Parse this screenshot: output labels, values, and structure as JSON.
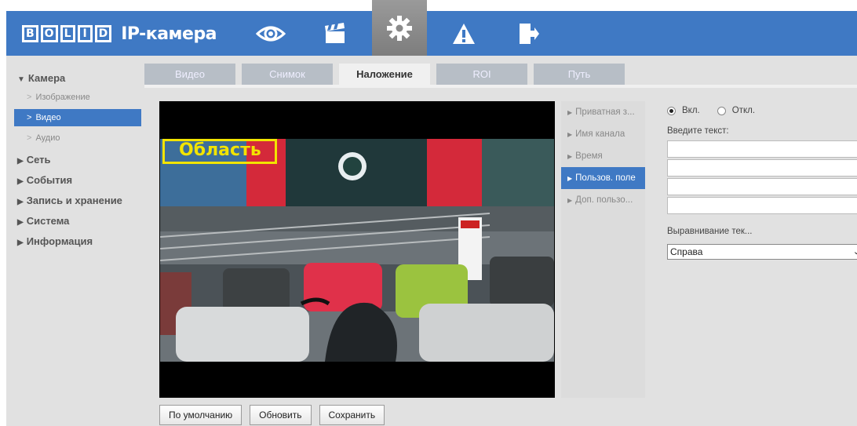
{
  "header": {
    "logo_letters": [
      "B",
      "O",
      "L",
      "I",
      "D"
    ],
    "app_title": "IP-камера",
    "nav_icons": [
      {
        "name": "live-view-eye-icon",
        "active": false
      },
      {
        "name": "playback-clapper-icon",
        "active": false
      },
      {
        "name": "settings-gear-icon",
        "active": true
      },
      {
        "name": "alarm-warning-icon",
        "active": false
      },
      {
        "name": "logout-door-icon",
        "active": false
      }
    ],
    "brand_color": "#3f79c4"
  },
  "sidebar": {
    "groups": [
      {
        "label": "Камера",
        "expanded": true
      },
      {
        "label": "Сеть"
      },
      {
        "label": "События"
      },
      {
        "label": "Запись и хранение"
      },
      {
        "label": "Система"
      },
      {
        "label": "Информация"
      }
    ],
    "camera_items": [
      {
        "label": "Изображение"
      },
      {
        "label": "Видео",
        "selected": true
      },
      {
        "label": "Аудио"
      }
    ]
  },
  "tabs": [
    {
      "label": "Видео"
    },
    {
      "label": "Снимок"
    },
    {
      "label": "Наложение",
      "active": true
    },
    {
      "label": "ROI"
    },
    {
      "label": "Путь"
    }
  ],
  "video": {
    "osd_text": "Область",
    "osd_color": "#f2e400"
  },
  "overlay_items": [
    {
      "label": "Приватная з..."
    },
    {
      "label": "Имя канала"
    },
    {
      "label": "Время"
    },
    {
      "label": "Пользов. поле",
      "selected": true
    },
    {
      "label": "Доп. пользо..."
    }
  ],
  "settings": {
    "on_label": "Вкл.",
    "off_label": "Откл.",
    "enabled": true,
    "text_prompt": "Введите текст:",
    "text_lines": [
      "",
      "",
      "",
      ""
    ],
    "align_label": "Выравнивание тек...",
    "align_value": "Справа"
  },
  "buttons": {
    "default_label": "По умолчанию",
    "refresh_label": "Обновить",
    "save_label": "Сохранить"
  }
}
